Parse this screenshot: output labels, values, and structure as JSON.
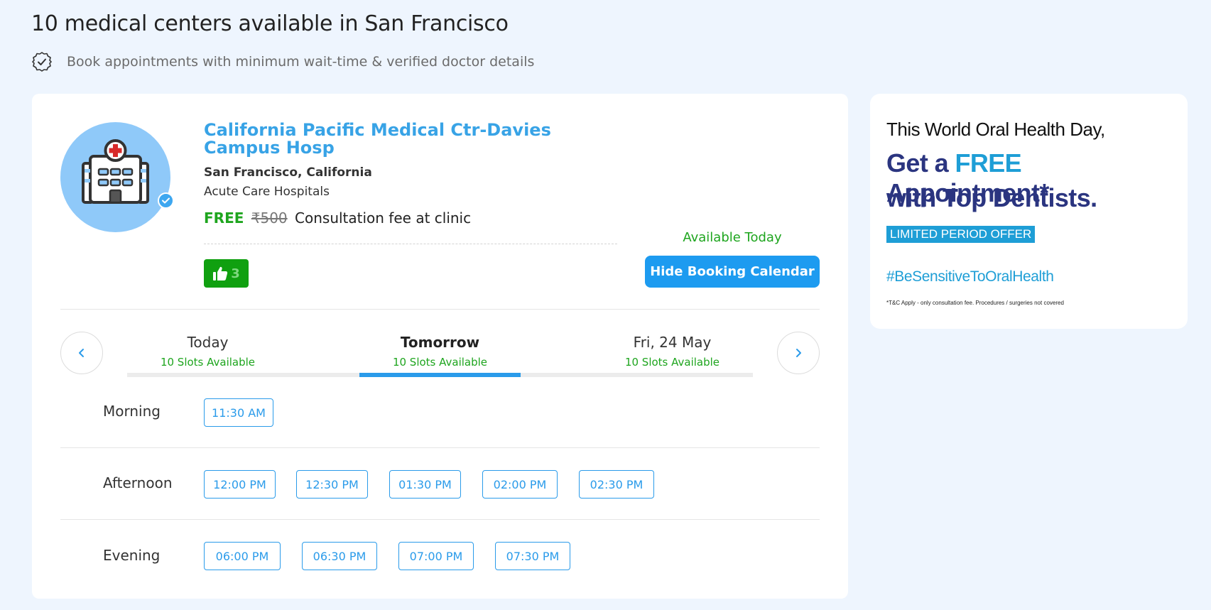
{
  "header": {
    "title": "10 medical centers available in San Francisco",
    "subtitle": "Book appointments with minimum wait-time & verified doctor details",
    "subtitle_icon": "check-circle-icon"
  },
  "listing": {
    "avatar_icon": "hospital-building-icon",
    "verified_icon": "verified-check-icon",
    "name": "California Pacific Medical Ctr-Davies Campus Hosp",
    "location": "San Francisco, California",
    "type": "Acute Care Hospitals",
    "fee": {
      "free_label": "FREE",
      "old_price": "₹500",
      "suffix": "Consultation fee at clinic"
    },
    "likes": {
      "icon": "thumbs-up-icon",
      "count": "3"
    },
    "availability": "Available Today",
    "hide_calendar_label": "Hide Booking Calendar"
  },
  "calendar": {
    "prev_icon": "chevron-left-icon",
    "next_icon": "chevron-right-icon",
    "days": [
      {
        "name": "Today",
        "slots": "10 Slots Available"
      },
      {
        "name": "Tomorrow",
        "slots": "10 Slots Available"
      },
      {
        "name": "Fri, 24 May",
        "slots": "10 Slots Available"
      }
    ],
    "active_day": "Tomorrow",
    "periods": [
      {
        "label": "Morning",
        "slots": [
          "11:30 AM"
        ]
      },
      {
        "label": "Afternoon",
        "slots": [
          "12:00 PM",
          "12:30 PM",
          "01:30 PM",
          "02:00 PM",
          "02:30 PM"
        ]
      },
      {
        "label": "Evening",
        "slots": [
          "06:00 PM",
          "06:30 PM",
          "07:00 PM",
          "07:30 PM"
        ]
      }
    ]
  },
  "ad": {
    "line1": "This World Oral Health Day,",
    "line2_prefix": "Get a ",
    "line2_free": "FREE",
    "line2_suffix": " Appointment*",
    "line3": "with Top Dentists.",
    "offer": "LIMITED PERIOD OFFER",
    "hashtag": "#BeSensitiveToOralHealth",
    "terms": "*T&C Apply - only consultation fee. Procedures / surgeries not covered"
  },
  "colors": {
    "accent_blue": "#1d9bf0",
    "name_blue": "#38a3e6",
    "green": "#1ea51e",
    "ad_navy": "#2b3580",
    "ad_cyan": "#1e9ed6",
    "page_bg": "#eef5fe"
  }
}
